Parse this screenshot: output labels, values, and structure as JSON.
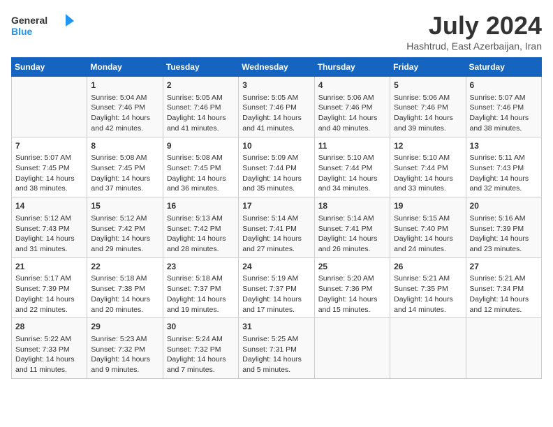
{
  "header": {
    "logo_line1": "General",
    "logo_line2": "Blue",
    "month": "July 2024",
    "location": "Hashtrud, East Azerbaijan, Iran"
  },
  "days_of_week": [
    "Sunday",
    "Monday",
    "Tuesday",
    "Wednesday",
    "Thursday",
    "Friday",
    "Saturday"
  ],
  "weeks": [
    [
      {
        "day": "",
        "content": ""
      },
      {
        "day": "1",
        "content": "Sunrise: 5:04 AM\nSunset: 7:46 PM\nDaylight: 14 hours\nand 42 minutes."
      },
      {
        "day": "2",
        "content": "Sunrise: 5:05 AM\nSunset: 7:46 PM\nDaylight: 14 hours\nand 41 minutes."
      },
      {
        "day": "3",
        "content": "Sunrise: 5:05 AM\nSunset: 7:46 PM\nDaylight: 14 hours\nand 41 minutes."
      },
      {
        "day": "4",
        "content": "Sunrise: 5:06 AM\nSunset: 7:46 PM\nDaylight: 14 hours\nand 40 minutes."
      },
      {
        "day": "5",
        "content": "Sunrise: 5:06 AM\nSunset: 7:46 PM\nDaylight: 14 hours\nand 39 minutes."
      },
      {
        "day": "6",
        "content": "Sunrise: 5:07 AM\nSunset: 7:46 PM\nDaylight: 14 hours\nand 38 minutes."
      }
    ],
    [
      {
        "day": "7",
        "content": "Sunrise: 5:07 AM\nSunset: 7:45 PM\nDaylight: 14 hours\nand 38 minutes."
      },
      {
        "day": "8",
        "content": "Sunrise: 5:08 AM\nSunset: 7:45 PM\nDaylight: 14 hours\nand 37 minutes."
      },
      {
        "day": "9",
        "content": "Sunrise: 5:08 AM\nSunset: 7:45 PM\nDaylight: 14 hours\nand 36 minutes."
      },
      {
        "day": "10",
        "content": "Sunrise: 5:09 AM\nSunset: 7:44 PM\nDaylight: 14 hours\nand 35 minutes."
      },
      {
        "day": "11",
        "content": "Sunrise: 5:10 AM\nSunset: 7:44 PM\nDaylight: 14 hours\nand 34 minutes."
      },
      {
        "day": "12",
        "content": "Sunrise: 5:10 AM\nSunset: 7:44 PM\nDaylight: 14 hours\nand 33 minutes."
      },
      {
        "day": "13",
        "content": "Sunrise: 5:11 AM\nSunset: 7:43 PM\nDaylight: 14 hours\nand 32 minutes."
      }
    ],
    [
      {
        "day": "14",
        "content": "Sunrise: 5:12 AM\nSunset: 7:43 PM\nDaylight: 14 hours\nand 31 minutes."
      },
      {
        "day": "15",
        "content": "Sunrise: 5:12 AM\nSunset: 7:42 PM\nDaylight: 14 hours\nand 29 minutes."
      },
      {
        "day": "16",
        "content": "Sunrise: 5:13 AM\nSunset: 7:42 PM\nDaylight: 14 hours\nand 28 minutes."
      },
      {
        "day": "17",
        "content": "Sunrise: 5:14 AM\nSunset: 7:41 PM\nDaylight: 14 hours\nand 27 minutes."
      },
      {
        "day": "18",
        "content": "Sunrise: 5:14 AM\nSunset: 7:41 PM\nDaylight: 14 hours\nand 26 minutes."
      },
      {
        "day": "19",
        "content": "Sunrise: 5:15 AM\nSunset: 7:40 PM\nDaylight: 14 hours\nand 24 minutes."
      },
      {
        "day": "20",
        "content": "Sunrise: 5:16 AM\nSunset: 7:39 PM\nDaylight: 14 hours\nand 23 minutes."
      }
    ],
    [
      {
        "day": "21",
        "content": "Sunrise: 5:17 AM\nSunset: 7:39 PM\nDaylight: 14 hours\nand 22 minutes."
      },
      {
        "day": "22",
        "content": "Sunrise: 5:18 AM\nSunset: 7:38 PM\nDaylight: 14 hours\nand 20 minutes."
      },
      {
        "day": "23",
        "content": "Sunrise: 5:18 AM\nSunset: 7:37 PM\nDaylight: 14 hours\nand 19 minutes."
      },
      {
        "day": "24",
        "content": "Sunrise: 5:19 AM\nSunset: 7:37 PM\nDaylight: 14 hours\nand 17 minutes."
      },
      {
        "day": "25",
        "content": "Sunrise: 5:20 AM\nSunset: 7:36 PM\nDaylight: 14 hours\nand 15 minutes."
      },
      {
        "day": "26",
        "content": "Sunrise: 5:21 AM\nSunset: 7:35 PM\nDaylight: 14 hours\nand 14 minutes."
      },
      {
        "day": "27",
        "content": "Sunrise: 5:21 AM\nSunset: 7:34 PM\nDaylight: 14 hours\nand 12 minutes."
      }
    ],
    [
      {
        "day": "28",
        "content": "Sunrise: 5:22 AM\nSunset: 7:33 PM\nDaylight: 14 hours\nand 11 minutes."
      },
      {
        "day": "29",
        "content": "Sunrise: 5:23 AM\nSunset: 7:32 PM\nDaylight: 14 hours\nand 9 minutes."
      },
      {
        "day": "30",
        "content": "Sunrise: 5:24 AM\nSunset: 7:32 PM\nDaylight: 14 hours\nand 7 minutes."
      },
      {
        "day": "31",
        "content": "Sunrise: 5:25 AM\nSunset: 7:31 PM\nDaylight: 14 hours\nand 5 minutes."
      },
      {
        "day": "",
        "content": ""
      },
      {
        "day": "",
        "content": ""
      },
      {
        "day": "",
        "content": ""
      }
    ]
  ]
}
